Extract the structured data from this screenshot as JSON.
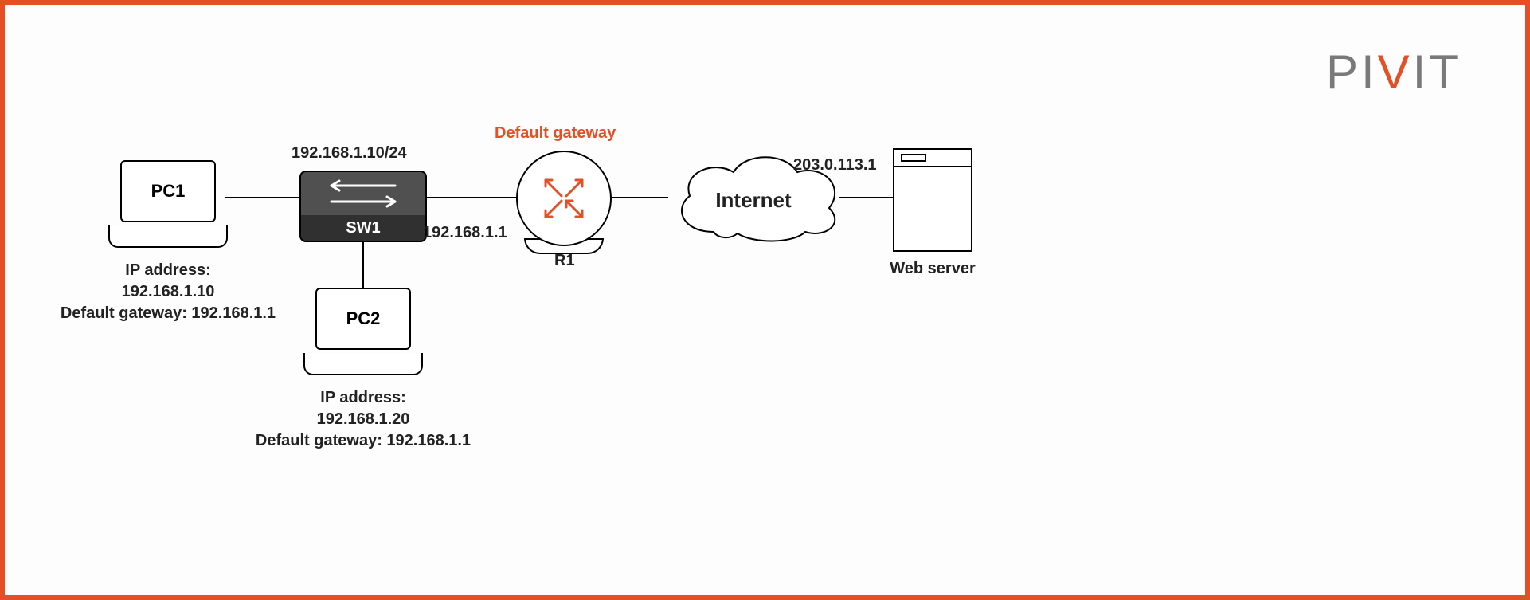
{
  "brand": {
    "p": "P",
    "i1": "I",
    "v": "V",
    "i2": "I",
    "t": "T"
  },
  "nodes": {
    "pc1": {
      "name": "PC1",
      "details": "IP address:\n192.168.1.10\nDefault gateway: 192.168.1.1"
    },
    "pc2": {
      "name": "PC2",
      "details": "IP address:\n192.168.1.20\nDefault gateway: 192.168.1.1"
    },
    "switch": {
      "name": "SW1",
      "subnet": "192.168.1.10/24"
    },
    "router": {
      "name": "R1",
      "title": "Default gateway",
      "lan_ip": "192.168.1.1"
    },
    "cloud": {
      "name": "Internet"
    },
    "server": {
      "name": "Web server",
      "wan_ip": "203.0.113.1"
    }
  }
}
